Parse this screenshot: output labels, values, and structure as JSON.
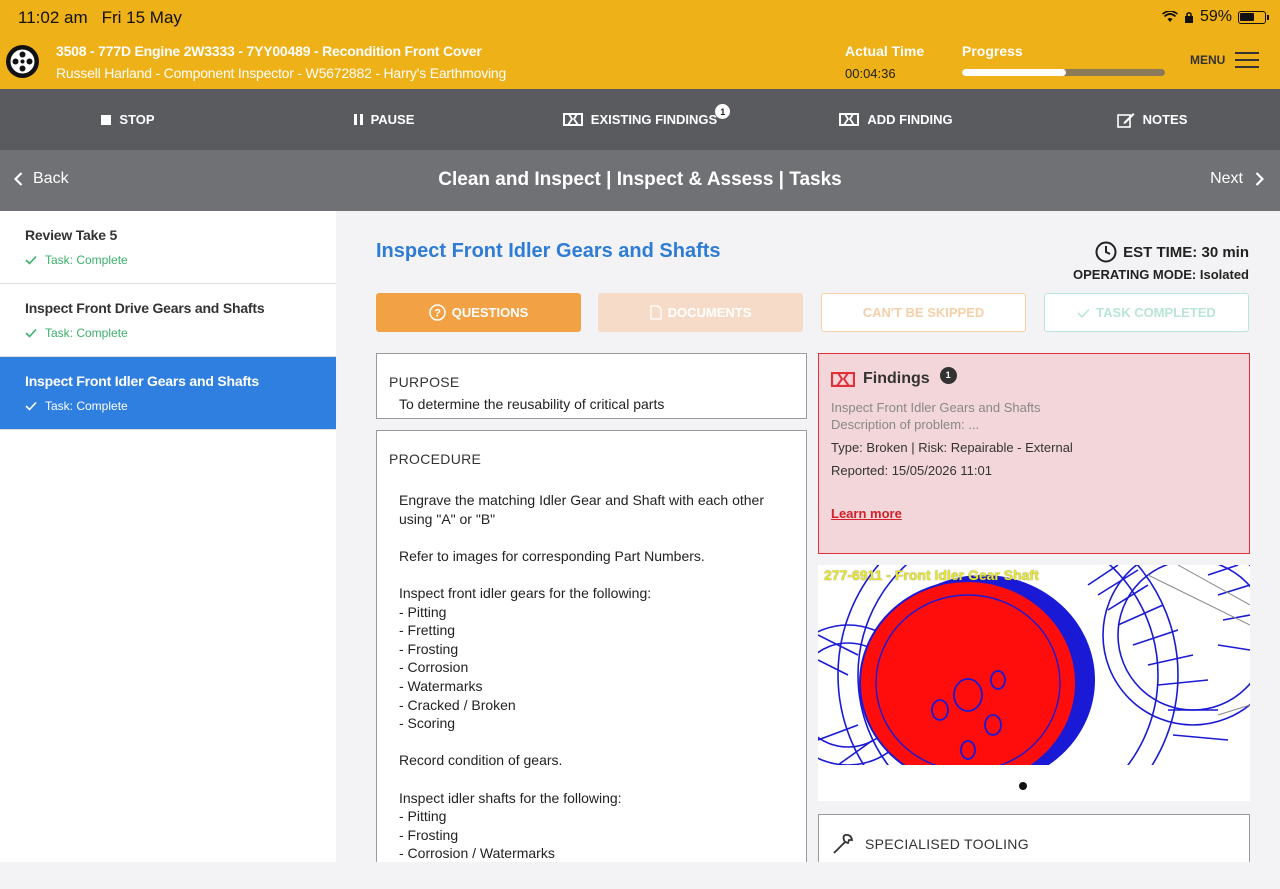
{
  "status_bar": {
    "time": "11:02 am",
    "date": "Fri 15 May",
    "battery": "59%"
  },
  "header": {
    "job_title": "3508 - 777D Engine 2W3333 - 7YY00489 - Recondition Front Cover",
    "job_subtitle": "Russell Harland - Component Inspector - W5672882 - Harry's Earthmoving",
    "actual_time_label": "Actual Time",
    "actual_time_value": "00:04:36",
    "progress_label": "Progress",
    "progress_fraction": 0.51,
    "menu_label": "MENU"
  },
  "toolbar": {
    "stop": "STOP",
    "pause": "PAUSE",
    "existing_findings": "EXISTING FINDINGS",
    "existing_findings_count": "1",
    "add_finding": "ADD FINDING",
    "notes": "NOTES"
  },
  "nav": {
    "back": "Back",
    "title": "Clean and Inspect | Inspect & Assess | Tasks",
    "next": "Next"
  },
  "sidebar": {
    "items": [
      {
        "title": "Review Take 5",
        "status": "Task: Complete"
      },
      {
        "title": "Inspect Front Drive Gears and Shafts",
        "status": "Task: Complete"
      },
      {
        "title": "Inspect Front Idler Gears and Shafts",
        "status": "Task: Complete"
      }
    ]
  },
  "task": {
    "title": "Inspect Front Idler Gears and Shafts",
    "est_time": "EST TIME: 30 min",
    "operating_mode": "OPERATING MODE: Isolated",
    "buttons": {
      "questions": "QUESTIONS",
      "documents": "DOCUMENTS",
      "cant_skip": "CAN'T BE SKIPPED",
      "task_completed": "TASK COMPLETED"
    },
    "purpose_label": "PURPOSE",
    "purpose_text": "To determine the reusability of critical parts",
    "procedure_label": "PROCEDURE",
    "procedure_lines": [
      "Engrave the matching Idler Gear and Shaft with each other",
      "using \"A\" or \"B\"",
      "",
      "Refer to images for corresponding Part Numbers.",
      "",
      "Inspect front idler gears for the following:",
      "- Pitting",
      "- Fretting",
      "- Frosting",
      "- Corrosion",
      "- Watermarks",
      "- Cracked / Broken",
      "- Scoring",
      "",
      "Record condition of gears.",
      "",
      "Inspect idler shafts for the following:",
      "- Pitting",
      "- Frosting",
      "- Corrosion / Watermarks"
    ]
  },
  "findings": {
    "label": "Findings",
    "count": "1",
    "line1": "Inspect Front Idler Gears and Shafts",
    "line2": "Description of problem: ...",
    "line3": "Type: Broken | Risk: Repairable - External",
    "line4": "Reported: 15/05/2026 11:01",
    "learn_more": "Learn more"
  },
  "image": {
    "caption": "277-6911 - Front Idler Gear Shaft"
  },
  "tooling": {
    "label": "SPECIALISED TOOLING"
  },
  "colors": {
    "header": "#eeb117",
    "accent_blue": "#2e7cd6",
    "questions_orange": "#f2a145",
    "finding_red": "#e0303a"
  }
}
